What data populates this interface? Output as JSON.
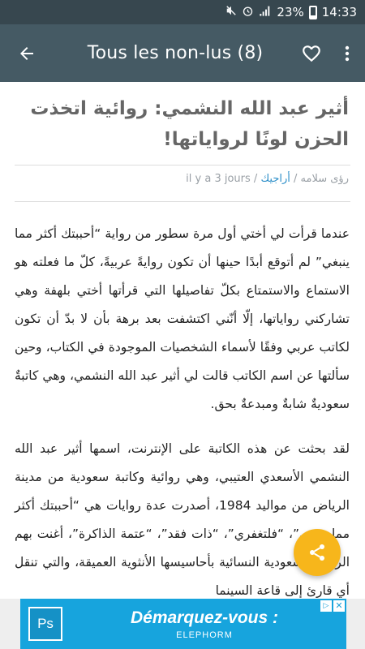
{
  "status_bar": {
    "icons": [
      "mute-icon",
      "alarm-icon",
      "signal-icon"
    ],
    "battery": "23%",
    "time": "14:33"
  },
  "app_bar": {
    "title": "Tous les non-lus (8)",
    "back_icon": "arrow-left-icon",
    "favorite_icon": "heart-outline-icon",
    "menu_icon": "more-vert-icon"
  },
  "article": {
    "title": "أثير عبد الله النشمي: روائية اتخذت الحزن لونًا لرواياتها!",
    "author": "رؤى سلامه",
    "separator": "/",
    "category": "أراجيك",
    "date": "il y a 3 jours",
    "paragraphs": [
      "عندما قرأت لي أختي أول مرة سطور من رواية “أحببتك أكثر مما ينبغي” لم أتوقع أبدًا حينها أن تكون روايةً عربيةً، كلّ ما فعلته هو الاستماع والاستمتاع بكلّ تفاصيلها التي قرأتها أختي بلهفة وهي تشاركني رواياتها، إلّا أنّني اكتشفت بعد برهة بأن لا بدّ أن تكون لكاتب عربي وفقًا لأسماء الشخصيات الموجودة في الكتاب، وحين سألتها عن اسم الكاتب قالت لي أثير عبد الله النشمي، وهي كاتبةٌ سعوديةٌ شابةٌ ومبدعةٌ بحق.",
      "لقد بحثت عن هذه الكاتبة على الإنترنت، اسمها أثير عبد الله النشمي الأسعدي العتيبي، وهي روائية وكاتبة سعودية من مدينة الرياض من مواليد 1984، أصدرت عدة روايات هي “أحببتك أكثر مما ينبغي”، “فلتغفري”، “ذات فقد”، “عتمة الذاكرة”، أغنت بهم الرواية السعودية النسائية بأحاسيسها الأنثوية العميقة، والتي تنقل أي قارئ إلى قاعة السينما"
    ]
  },
  "fab": {
    "icon": "share-icon",
    "color": "#f7b61b"
  },
  "ad": {
    "logo_text": "Ps",
    "headline": "Démarquez-vous :",
    "brand": "ELEPHORM",
    "close_label": "✕",
    "adchoices_label": "▷",
    "color": "#17a4dd"
  },
  "colors": {
    "status_bar": "#37474f",
    "app_bar": "#455a64",
    "category_link": "#2d8fc9"
  }
}
